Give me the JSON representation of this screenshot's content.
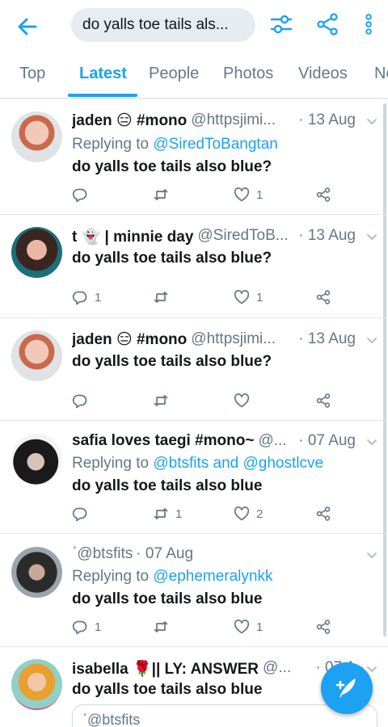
{
  "search": {
    "query": "do yalls toe tails als..."
  },
  "tabs": [
    {
      "label": "Top"
    },
    {
      "label": "Latest"
    },
    {
      "label": "People"
    },
    {
      "label": "Photos"
    },
    {
      "label": "Videos"
    },
    {
      "label": "News"
    }
  ],
  "colors": {
    "accent": "#1da1f2",
    "muted": "#657786",
    "text": "#14171a"
  },
  "tweets": [
    {
      "name": "jaden 😑 #mono",
      "handle": "@httpsjimi...",
      "time": "· 13 Aug",
      "reply_prefix": "Replying to ",
      "reply_to": "@SiredToBangtan",
      "text": "do yalls toe tails also blue?",
      "counts": {
        "reply": "",
        "retweet": "",
        "like": "1"
      }
    },
    {
      "name": "t 👻 | minnie day",
      "handle": "@SiredToB...",
      "time": "· 13 Aug",
      "text": "do yalls toe tails also blue?",
      "counts": {
        "reply": "1",
        "retweet": "",
        "like": "1"
      }
    },
    {
      "name": "jaden 😑 #mono",
      "handle": "@httpsjimi...",
      "time": "· 13 Aug",
      "text": "do yalls toe tails also blue?",
      "counts": {
        "reply": "",
        "retweet": "",
        "like": ""
      }
    },
    {
      "name": "safia loves taegi #mono~",
      "handle": "@...",
      "time": "· 07 Aug",
      "reply_prefix": "Replying to ",
      "reply_to": "@btsfits and @ghostlcve",
      "text": "do yalls toe tails also blue",
      "counts": {
        "reply": "",
        "retweet": "1",
        "like": "2"
      }
    },
    {
      "name": "ˊ",
      "handle": "@btsfits",
      "time": "· 07 Aug",
      "reply_prefix": "Replying to ",
      "reply_to": "@ephemeralynkk",
      "text": "do yalls toe tails also blue",
      "counts": {
        "reply": "1",
        "retweet": "",
        "like": "1"
      }
    },
    {
      "name": "isabella 🌹|| LY: ANSWER",
      "handle": "@...",
      "time": "· 07 A",
      "text": "do yalls toe tails also blue",
      "quote_handle": "ˊ@btsfits"
    }
  ],
  "icons": {
    "back": "arrow-left-icon",
    "filter": "sliders-icon",
    "share": "share-icon",
    "more": "kebab-icon",
    "reply": "comment-icon",
    "retweet": "retweet-icon",
    "like": "heart-icon",
    "compose": "feather-plus-icon"
  }
}
